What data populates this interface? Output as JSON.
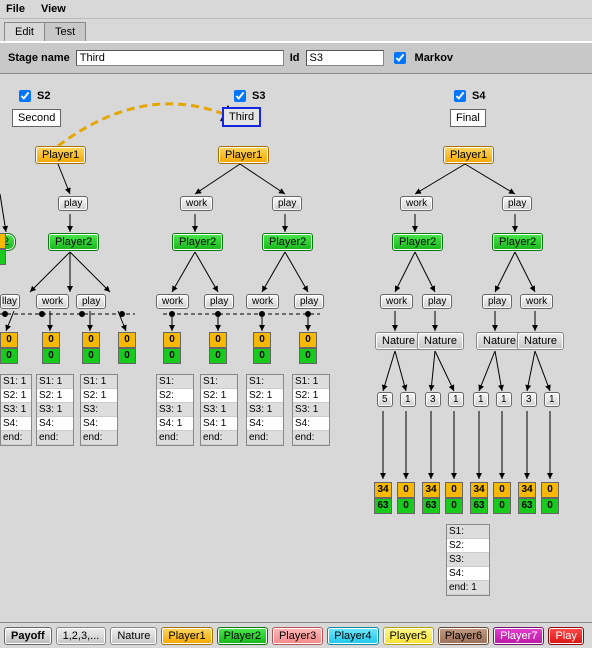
{
  "menu": {
    "file": "File",
    "view": "View"
  },
  "tabs": {
    "edit": "Edit",
    "test": "Test"
  },
  "stagebar": {
    "name_lbl": "Stage name",
    "name_val": "Third",
    "id_lbl": "Id",
    "id_val": "S3",
    "markov_lbl": "Markov"
  },
  "hdrs": {
    "s2": "S2",
    "s3": "S3",
    "s4": "S4"
  },
  "stageboxes": {
    "s2": "Second",
    "s3": "Third",
    "s4": "Final"
  },
  "player1": "Player1",
  "player2": "Player2",
  "nature": "Nature",
  "acts": {
    "play": "play",
    "work": "work"
  },
  "pay": {
    "z": "0",
    "a34": "34",
    "a63": "63"
  },
  "sbox_left": [
    [
      "S1: 1",
      "S2: 1",
      "S3: 1",
      "S4:",
      "end:"
    ],
    [
      "S1: 1",
      "S2: 1",
      "S3: 1",
      "S4:",
      "end:"
    ],
    [
      "S1: 1",
      "S2: 1",
      "S3:",
      "S4:",
      "end:"
    ]
  ],
  "sbox_mid": [
    [
      "S1:",
      "S2:",
      "S3: 1",
      "S4: 1",
      "end:"
    ],
    [
      "S1:",
      "S2: 1",
      "S3: 1",
      "S4: 1",
      "end:"
    ],
    [
      "S1:",
      "S2: 1",
      "S3: 1",
      "S4:",
      "end:"
    ],
    [
      "S1: 1",
      "S2: 1",
      "S3: 1",
      "S4:",
      "end:"
    ]
  ],
  "nat": {
    "n5": "5",
    "n1": "1",
    "n3": "3"
  },
  "sbox_right": [
    "S1:",
    "S2:",
    "S3:",
    "S4:",
    "end: 1"
  ],
  "footer": {
    "payoff": "Payoff",
    "num": "1,2,3,...",
    "nature": "Nature",
    "p1": "Player1",
    "p2": "Player2",
    "p3": "Player3",
    "p4": "Player4",
    "p5": "Player5",
    "p6": "Player6",
    "p7": "Player7",
    "p8": "Play"
  }
}
